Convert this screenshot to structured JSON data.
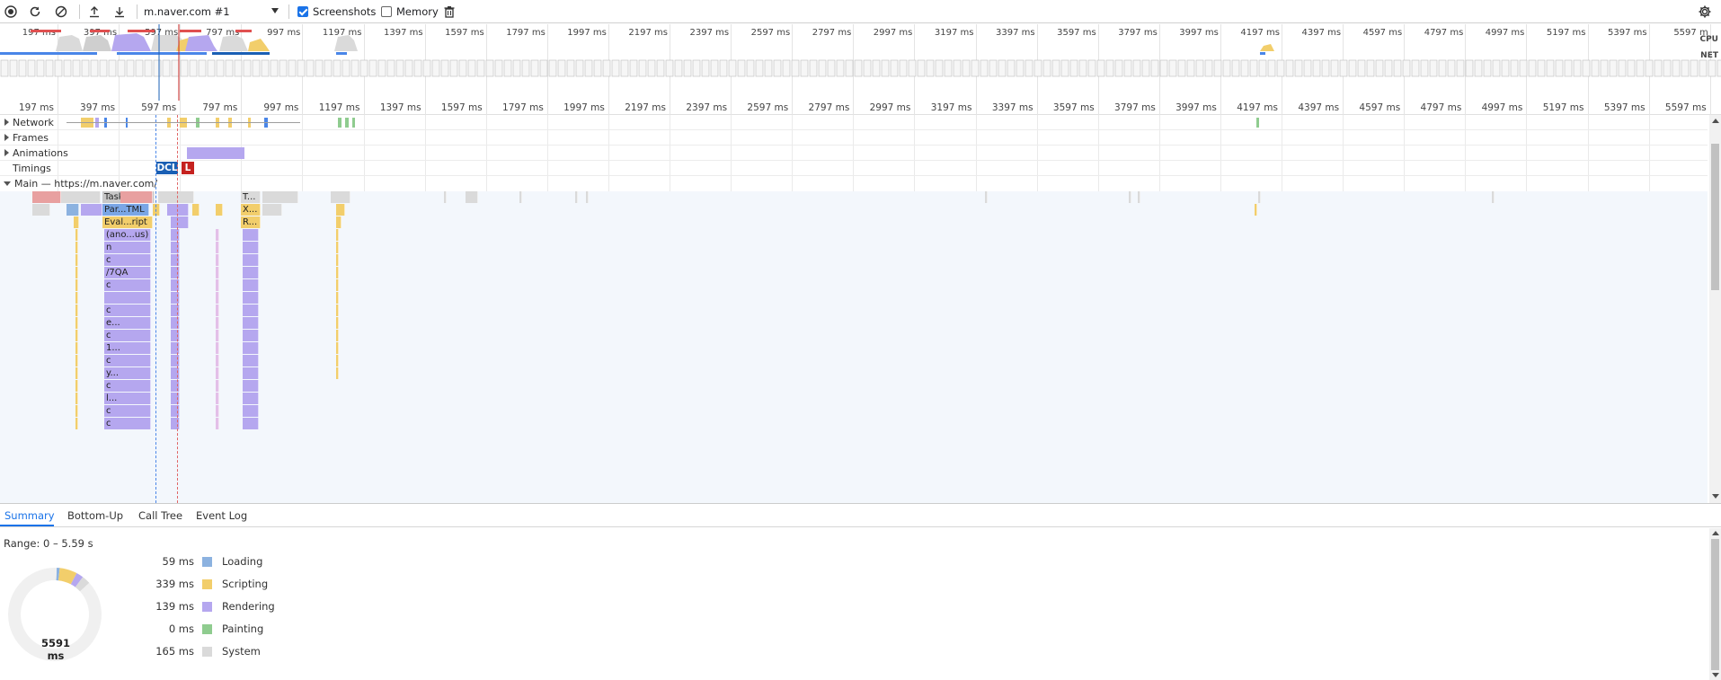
{
  "toolbar": {
    "target": "m.naver.com #1",
    "screenshots_label": "Screenshots",
    "screenshots_checked": true,
    "memory_label": "Memory",
    "memory_checked": false
  },
  "overview": {
    "ticks": [
      "197 ms",
      "397 ms",
      "597 ms",
      "797 ms",
      "997 ms",
      "1197 ms",
      "1397 ms",
      "1597 ms",
      "1797 ms",
      "1997 ms",
      "2197 ms",
      "2397 ms",
      "2597 ms",
      "2797 ms",
      "2997 ms",
      "3197 ms",
      "3397 ms",
      "3597 ms",
      "3797 ms",
      "3997 ms",
      "4197 ms",
      "4397 ms",
      "4597 ms",
      "4797 ms",
      "4997 ms",
      "5197 ms",
      "5397 ms",
      "5597 m"
    ],
    "cpu_label": "CPU",
    "net_label": "NET"
  },
  "ruler": {
    "ticks": [
      "197 ms",
      "397 ms",
      "597 ms",
      "797 ms",
      "997 ms",
      "1197 ms",
      "1397 ms",
      "1597 ms",
      "1797 ms",
      "1997 ms",
      "2197 ms",
      "2397 ms",
      "2597 ms",
      "2797 ms",
      "2997 ms",
      "3197 ms",
      "3397 ms",
      "3597 ms",
      "3797 ms",
      "3997 ms",
      "4197 ms",
      "4397 ms",
      "4597 ms",
      "4797 ms",
      "4997 ms",
      "5197 ms",
      "5397 ms",
      "5597 ms"
    ]
  },
  "tracks": {
    "network": "Network",
    "frames": "Frames",
    "animations": "Animations",
    "timings": "Timings",
    "main": "Main — https://m.naver.com/",
    "dcl": "DCL",
    "l": "L"
  },
  "flame": {
    "task": "Task",
    "t_dots": "T...",
    "parse_html": "Par...TML",
    "x_dots": "X...",
    "eval_script": "Eval...ript",
    "r_dots": "R...",
    "stack": [
      "(ano...us)",
      "n",
      "c",
      "/7QA",
      "c",
      "",
      "c",
      "e...",
      "c",
      "1...",
      "c",
      "y...",
      "c",
      "l...",
      "c",
      "c"
    ]
  },
  "bottom": {
    "tabs": [
      "Summary",
      "Bottom-Up",
      "Call Tree",
      "Event Log"
    ],
    "range": "Range: 0 – 5.59 s",
    "total": "5591 ms",
    "legend": [
      {
        "value": "59 ms",
        "name": "Loading",
        "color": "#8cb2e0"
      },
      {
        "value": "339 ms",
        "name": "Scripting",
        "color": "#f2ce6b"
      },
      {
        "value": "139 ms",
        "name": "Rendering",
        "color": "#b5a7ef"
      },
      {
        "value": "0 ms",
        "name": "Painting",
        "color": "#8fcc8f"
      },
      {
        "value": "165 ms",
        "name": "System",
        "color": "#dadada"
      }
    ]
  },
  "colors": {
    "scripting": "#f2ce6b",
    "rendering": "#b5a7ef",
    "loading": "#8cb2e0",
    "system": "#dadada",
    "painting": "#8fcc8f",
    "dcl": "#1a5fb4",
    "load": "#c5221f",
    "accent": "#1a73e8"
  }
}
